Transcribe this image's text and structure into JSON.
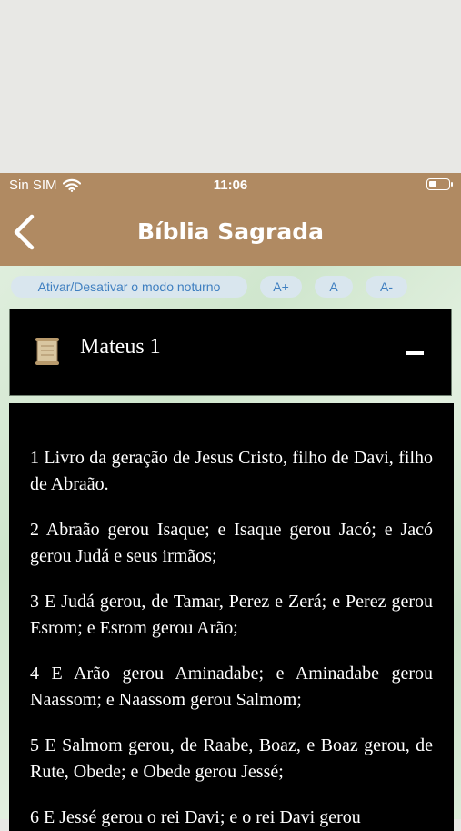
{
  "status": {
    "carrier": "Sin SIM",
    "time": "11:06"
  },
  "nav": {
    "title": "Bíblia Sagrada"
  },
  "toolbar": {
    "night_mode": "Ativar/Desativar o modo noturno",
    "font_larger": "A+",
    "font_normal": "A",
    "font_smaller": "A-"
  },
  "chapter": {
    "title": "Mateus 1"
  },
  "verses": [
    "1 Livro da geração de Jesus Cristo, filho de Davi, filho de Abraão.",
    "2 Abraão gerou Isaque; e Isaque gerou Jacó; e Jacó gerou Judá e seus irmãos;",
    "3 E Judá gerou, de Tamar, Perez e Zerá; e Perez gerou Esrom; e Esrom gerou Arão;",
    "4 E Arão gerou Aminadabe; e Aminadabe gerou Naassom; e Naassom gerou Salmom;",
    "5 E Salmom gerou, de Raabe, Boaz, e Boaz gerou, de Rute, Obede; e Obede gerou Jessé;",
    "6 E Jessé gerou o rei Davi; e o rei Davi gerou"
  ],
  "colors": {
    "bar": "#b08a62",
    "accent": "#3f7fc0"
  },
  "icons": {
    "back": "chevron-left-icon",
    "book": "scroll-icon",
    "collapse": "minus-icon",
    "wifi": "wifi-icon",
    "battery": "battery-icon"
  }
}
